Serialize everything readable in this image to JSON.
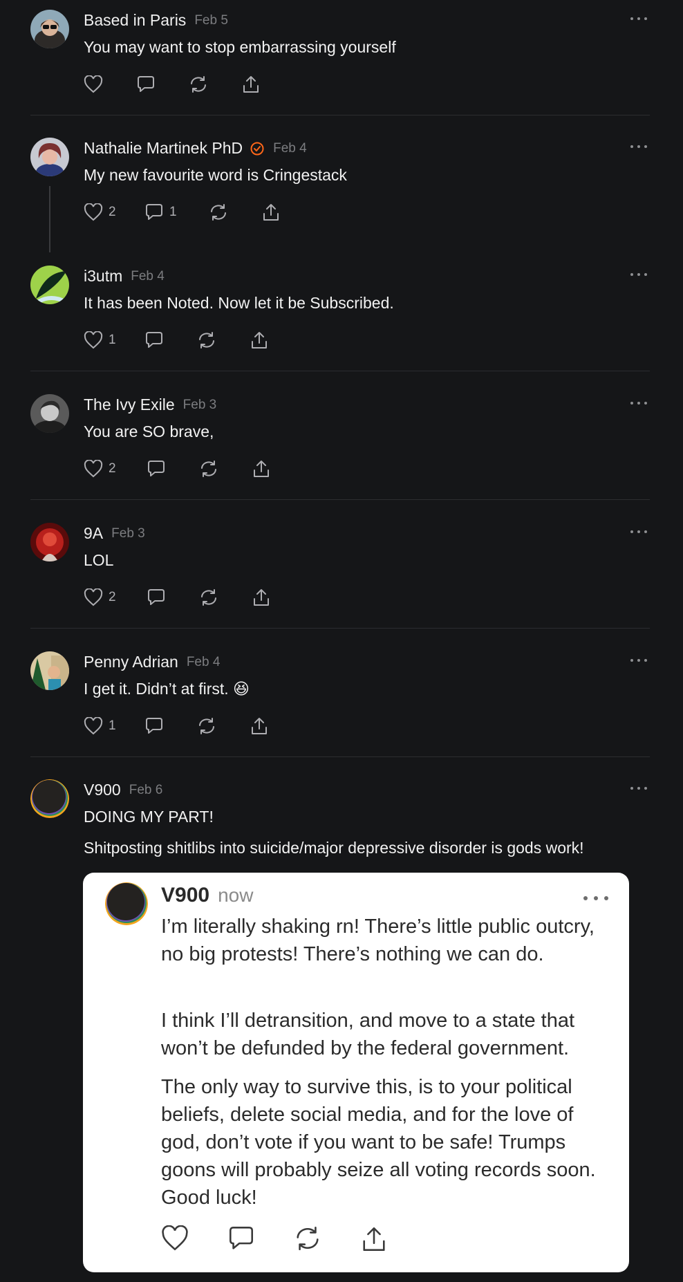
{
  "comments": [
    {
      "author": "Based in Paris",
      "date": "Feb 5",
      "text": "You may want to stop embarrassing yourself",
      "likes": "",
      "replies": "",
      "avatar": "woman-sunglasses-avatar"
    },
    {
      "author": "Nathalie Martinek PhD",
      "date": "Feb 4",
      "text": "My new favourite word is Cringestack",
      "likes": "2",
      "replies": "1",
      "verified": true,
      "avatar": "woman-portrait-avatar"
    },
    {
      "author": "i3utm",
      "date": "Feb 4",
      "text": "It has been Noted. Now let it be Subscribed.",
      "likes": "1",
      "replies": "",
      "avatar": "green-leaf-avatar"
    },
    {
      "author": "The Ivy Exile",
      "date": "Feb 3",
      "text": "You are SO brave,",
      "likes": "2",
      "replies": "",
      "avatar": "bw-man-avatar"
    },
    {
      "author": "9A",
      "date": "Feb 3",
      "text": "LOL",
      "likes": "2",
      "replies": "",
      "avatar": "red-portrait-avatar"
    },
    {
      "author": "Penny Adrian",
      "date": "Feb 4",
      "text": "I get it. Didn’t at first. 😆",
      "likes": "1",
      "replies": "",
      "avatar": "selfie-avatar"
    },
    {
      "author": "V900",
      "date": "Feb 6",
      "text": "DOING MY PART!",
      "text2": "Shitposting shitlibs into suicide/major depressive disorder is gods work!",
      "likes": "",
      "replies": "",
      "avatar": "dark-orb-avatar"
    }
  ],
  "embedded": {
    "author": "V900",
    "date": "now",
    "paragraphs": [
      "I’m literally shaking rn! There’s little public outcry, no big protests! There’s nothing we can do.",
      "I think I’ll detransition, and move to a state that won’t be defunded by the federal government.",
      "The only way to survive this, is to your political beliefs, delete social media, and for the love of god, don’t vote if you want to be safe! Trumps goons will probably seize all voting records soon. Good luck!"
    ]
  },
  "colors": {
    "background": "#151618",
    "divider": "#2c2d30",
    "muted": "#7c7d80",
    "verified": "#ff6719"
  }
}
